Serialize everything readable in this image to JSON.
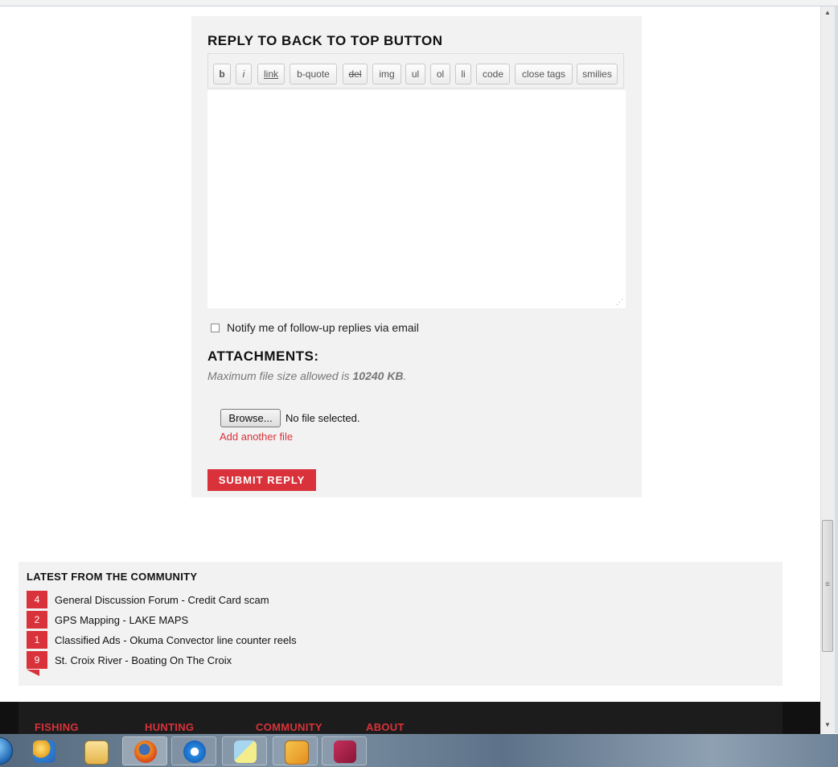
{
  "reply": {
    "title": "REPLY TO BACK TO TOP BUTTON",
    "toolbar": {
      "bold": "b",
      "italic": "i",
      "link": "link",
      "bquote": "b-quote",
      "del": "del",
      "img": "img",
      "ul": "ul",
      "ol": "ol",
      "li": "li",
      "code": "code",
      "close_tags": "close tags",
      "smilies": "smilies"
    },
    "editor_value": "",
    "notify_label": "Notify me of follow-up replies via email",
    "notify_checked": false
  },
  "attachments": {
    "title": "ATTACHMENTS:",
    "info_prefix": "Maximum file size allowed is ",
    "max_size": "10240 KB",
    "info_suffix": ".",
    "browse_label": "Browse...",
    "file_status": "No file selected.",
    "add_another": "Add another file"
  },
  "submit_label": "SUBMIT REPLY",
  "community": {
    "title": "LATEST FROM THE COMMUNITY",
    "items": [
      {
        "count": "4",
        "text": "General Discussion Forum - Credit Card scam"
      },
      {
        "count": "2",
        "text": "GPS Mapping - LAKE MAPS"
      },
      {
        "count": "1",
        "text": "Classified Ads - Okuma Convector line counter reels"
      },
      {
        "count": "9",
        "text": "St. Croix River - Boating On The Croix"
      }
    ]
  },
  "footer": {
    "nav": [
      "FISHING",
      "HUNTING",
      "COMMUNITY",
      "ABOUT"
    ]
  },
  "taskbar": {
    "apps": [
      "start-orb",
      "paint-icon",
      "file-explorer-icon",
      "firefox-icon",
      "internet-explorer-icon",
      "sticky-notes-icon",
      "outlook-icon",
      "access-icon"
    ]
  },
  "colors": {
    "accent": "#d9323a",
    "panel": "#f2f2f2",
    "footer": "#1c1c1c"
  }
}
